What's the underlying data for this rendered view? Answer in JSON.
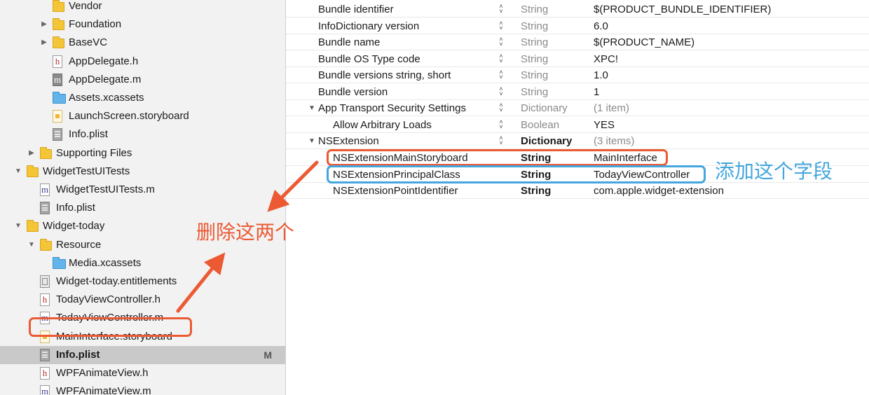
{
  "navigator": {
    "items": [
      {
        "label": "Vendor",
        "icon": "folder-icon",
        "type": "folder",
        "indent": 2,
        "disclosure": "none"
      },
      {
        "label": "Foundation",
        "icon": "folder-icon",
        "type": "folder",
        "indent": 2,
        "disclosure": "collapsed"
      },
      {
        "label": "BaseVC",
        "icon": "folder-icon",
        "type": "folder",
        "indent": 2,
        "disclosure": "collapsed"
      },
      {
        "label": "AppDelegate.h",
        "icon": "header-file-icon",
        "type": "h",
        "indent": 2,
        "disclosure": "none"
      },
      {
        "label": "AppDelegate.m",
        "icon": "implementation-file-icon",
        "type": "m-dark",
        "indent": 2,
        "disclosure": "none"
      },
      {
        "label": "Assets.xcassets",
        "icon": "asset-catalog-icon",
        "type": "assets",
        "indent": 2,
        "disclosure": "none"
      },
      {
        "label": "LaunchScreen.storyboard",
        "icon": "storyboard-file-icon",
        "type": "story",
        "indent": 2,
        "disclosure": "none"
      },
      {
        "label": "Info.plist",
        "icon": "plist-file-icon",
        "type": "plist",
        "indent": 2,
        "disclosure": "none"
      },
      {
        "label": "Supporting Files",
        "icon": "folder-icon",
        "type": "folder",
        "indent": 1,
        "disclosure": "collapsed"
      },
      {
        "label": "WidgetTestUITests",
        "icon": "folder-icon",
        "type": "folder",
        "indent": 0,
        "disclosure": "expanded"
      },
      {
        "label": "WidgetTestUITests.m",
        "icon": "implementation-file-icon",
        "type": "m",
        "indent": 1,
        "disclosure": "none"
      },
      {
        "label": "Info.plist",
        "icon": "plist-file-icon",
        "type": "plist",
        "indent": 1,
        "disclosure": "none"
      },
      {
        "label": "Widget-today",
        "icon": "folder-icon",
        "type": "folder",
        "indent": 0,
        "disclosure": "expanded"
      },
      {
        "label": "Resource",
        "icon": "folder-icon",
        "type": "folder",
        "indent": 1,
        "disclosure": "expanded"
      },
      {
        "label": "Media.xcassets",
        "icon": "asset-catalog-icon",
        "type": "assets",
        "indent": 2,
        "disclosure": "none"
      },
      {
        "label": "Widget-today.entitlements",
        "icon": "entitlements-file-icon",
        "type": "ent",
        "indent": 1,
        "disclosure": "none"
      },
      {
        "label": "TodayViewController.h",
        "icon": "header-file-icon",
        "type": "h",
        "indent": 1,
        "disclosure": "none"
      },
      {
        "label": "TodayViewController.m",
        "icon": "implementation-file-icon",
        "type": "m",
        "indent": 1,
        "disclosure": "none"
      },
      {
        "label": "MainInterface.storyboard",
        "icon": "storyboard-file-icon",
        "type": "story",
        "indent": 1,
        "disclosure": "none"
      },
      {
        "label": "Info.plist",
        "icon": "plist-file-icon",
        "type": "plist",
        "indent": 1,
        "disclosure": "none",
        "selected": true,
        "badge": "M"
      },
      {
        "label": "WPFAnimateView.h",
        "icon": "header-file-icon",
        "type": "h",
        "indent": 1,
        "disclosure": "none"
      },
      {
        "label": "WPFAnimateView.m",
        "icon": "implementation-file-icon",
        "type": "m",
        "indent": 1,
        "disclosure": "none"
      }
    ]
  },
  "plist": {
    "rows": [
      {
        "key": "Bundle identifier",
        "type": "String",
        "value": "$(PRODUCT_BUNDLE_IDENTIFIER)",
        "level": 0,
        "disclosure": "none"
      },
      {
        "key": "InfoDictionary version",
        "type": "String",
        "value": "6.0",
        "level": 0,
        "disclosure": "none"
      },
      {
        "key": "Bundle name",
        "type": "String",
        "value": "$(PRODUCT_NAME)",
        "level": 0,
        "disclosure": "none"
      },
      {
        "key": "Bundle OS Type code",
        "type": "String",
        "value": "XPC!",
        "level": 0,
        "disclosure": "none"
      },
      {
        "key": "Bundle versions string, short",
        "type": "String",
        "value": "1.0",
        "level": 0,
        "disclosure": "none"
      },
      {
        "key": "Bundle version",
        "type": "String",
        "value": "1",
        "level": 0,
        "disclosure": "none"
      },
      {
        "key": "App Transport Security Settings",
        "type": "Dictionary",
        "value": "(1 item)",
        "level": 0,
        "disclosure": "expanded",
        "value_muted": true
      },
      {
        "key": "Allow Arbitrary Loads",
        "type": "Boolean",
        "value": "YES",
        "level": 1,
        "disclosure": "none"
      },
      {
        "key": "NSExtension",
        "type": "Dictionary",
        "value": "(3 items)",
        "level": 0,
        "disclosure": "expanded",
        "value_muted": true,
        "bold_type": true
      },
      {
        "key": "NSExtensionMainStoryboard",
        "type": "String",
        "value": "MainInterface",
        "level": 1,
        "disclosure": "none",
        "bold_type": true,
        "no_stepper": true
      },
      {
        "key": "NSExtensionPrincipalClass",
        "type": "String",
        "value": "TodayViewController",
        "level": 1,
        "disclosure": "none",
        "bold_type": true,
        "no_stepper": true
      },
      {
        "key": "NSExtensionPointIdentifier",
        "type": "String",
        "value": "com.apple.widget-extension",
        "level": 1,
        "disclosure": "none",
        "bold_type": true,
        "no_stepper": true
      }
    ]
  },
  "annotations": {
    "add_field": "添加这个字段",
    "delete_two": "删除这两个",
    "colors": {
      "red": "#ec5a34",
      "blue": "#44a6dd"
    }
  }
}
